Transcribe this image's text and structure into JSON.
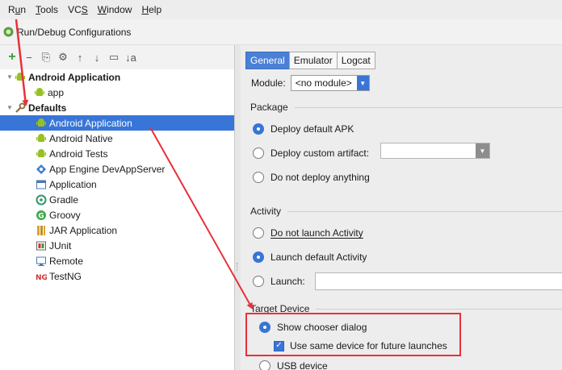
{
  "menu": [
    {
      "pre": "R",
      "u": "u",
      "post": "n"
    },
    {
      "pre": "",
      "u": "T",
      "post": "ools"
    },
    {
      "pre": "VC",
      "u": "S",
      "post": ""
    },
    {
      "pre": "",
      "u": "W",
      "post": "indow"
    },
    {
      "pre": "",
      "u": "H",
      "post": "elp"
    }
  ],
  "window": {
    "title": "Run/Debug Configurations"
  },
  "toolbar": {
    "add": "+",
    "remove": "−",
    "copy": "⎘",
    "edit": "⚙",
    "up": "↑",
    "down": "↓",
    "folder": "▭",
    "sort": "↓a"
  },
  "tree": {
    "android_application_group": "Android Application",
    "app": "app",
    "defaults": "Defaults",
    "items": [
      "Android Application",
      "Android Native",
      "Android Tests",
      "App Engine DevAppServer",
      "Application",
      "Gradle",
      "Groovy",
      "JAR Application",
      "JUnit",
      "Remote",
      "TestNG"
    ]
  },
  "tabs": [
    "General",
    "Emulator",
    "Logcat"
  ],
  "module": {
    "label": "Module:",
    "value": "<no module>"
  },
  "package": {
    "label": "Package",
    "deploy_default": "Deploy default APK",
    "deploy_custom": "Deploy custom artifact:",
    "no_deploy": "Do not deploy anything"
  },
  "activity": {
    "label": "Activity",
    "do_not_launch": "Do not launch Activity",
    "launch_default": "Launch default Activity",
    "launch": "Launch:"
  },
  "target": {
    "label": "Target Device",
    "show_chooser": "Show chooser dialog",
    "same_device": "Use same device for future launches",
    "usb": "USB device"
  },
  "colors": {
    "selection": "#3875d7",
    "annotation": "#e8313a",
    "android_green": "#97c024"
  }
}
